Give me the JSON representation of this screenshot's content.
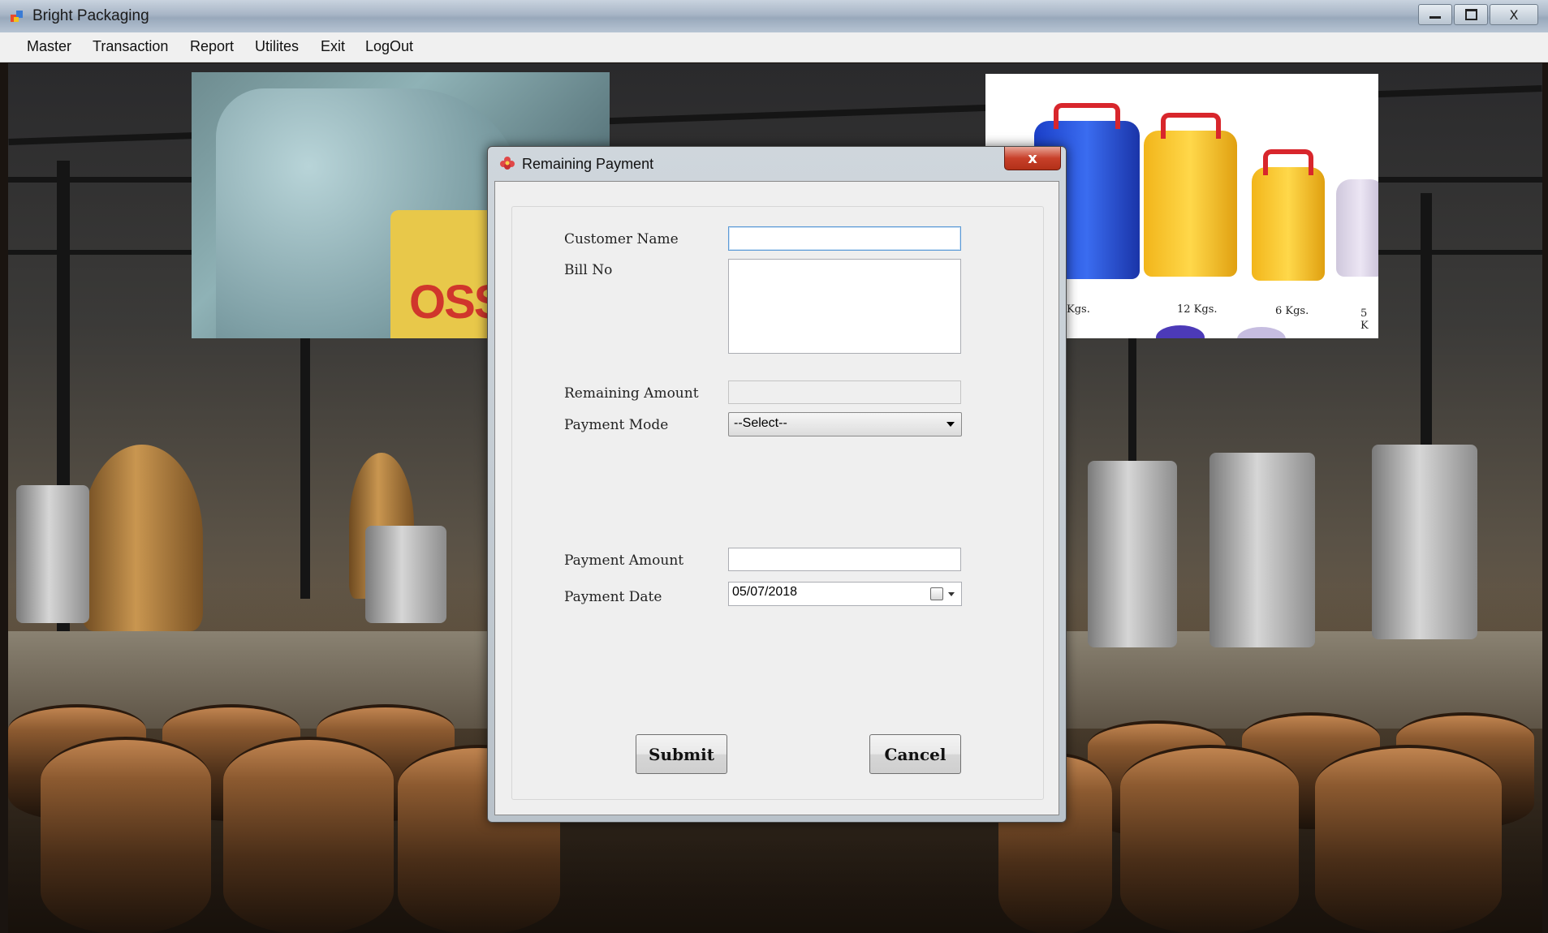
{
  "window": {
    "title": "Bright Packaging",
    "minimize_icon": "minimize-icon",
    "maximize_icon": "maximize-icon",
    "close_glyph": "X"
  },
  "menu": {
    "items": [
      "Master",
      "Transaction",
      "Report",
      "Utilites",
      "Exit",
      "LogOut"
    ]
  },
  "background": {
    "left_photo_text": "OSS",
    "right_photo_labels": [
      "Kgs.",
      "12 Kgs.",
      "6 Kgs.",
      "5 K"
    ]
  },
  "dialog": {
    "title": "Remaining Payment",
    "close_glyph": "x",
    "fields": {
      "customer_name": {
        "label": "Customer Name",
        "value": ""
      },
      "bill_no": {
        "label": "Bill No",
        "value": ""
      },
      "remaining_amount": {
        "label": "Remaining Amount",
        "value": ""
      },
      "payment_mode": {
        "label": "Payment Mode",
        "selected": "--Select--"
      },
      "payment_amount": {
        "label": "Payment Amount",
        "value": ""
      },
      "payment_date": {
        "label": "Payment Date",
        "value": "05/07/2018"
      }
    },
    "buttons": {
      "submit": "Submit",
      "cancel": "Cancel"
    }
  },
  "colors": {
    "dialog_close": "#c8402a",
    "focus_border": "#5c9ad6"
  }
}
